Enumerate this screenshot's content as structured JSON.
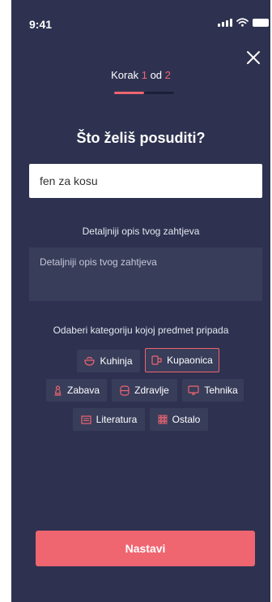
{
  "status_bar": {
    "time": "9:41"
  },
  "step": {
    "prefix": "Korak",
    "current": "1",
    "middle": "od",
    "total": "2",
    "progress_fraction": 0.5
  },
  "question": "Što želiš posuditi?",
  "item_input": {
    "value": "fen za kosu"
  },
  "description": {
    "label": "Detaljniji opis tvog zahtjeva",
    "placeholder": "Detaljniji opis tvog zahtjeva"
  },
  "category": {
    "label": "Odaberi kategoriju kojoj predmet pripada",
    "items": [
      {
        "label": "Kuhinja",
        "icon": "bowl-icon",
        "selected": false
      },
      {
        "label": "Kupaonica",
        "icon": "bathroom-icon",
        "selected": true
      },
      {
        "label": "Zabava",
        "icon": "chess-piece-icon",
        "selected": false
      },
      {
        "label": "Zdravlje",
        "icon": "health-icon",
        "selected": false
      },
      {
        "label": "Tehnika",
        "icon": "monitor-icon",
        "selected": false
      },
      {
        "label": "Literatura",
        "icon": "book-icon",
        "selected": false
      },
      {
        "label": "Ostalo",
        "icon": "grid-icon",
        "selected": false
      }
    ]
  },
  "continue_button": {
    "label": "Nastavi"
  },
  "colors": {
    "background": "#2e3250",
    "accent": "#ef6570",
    "field": "#383d5a"
  }
}
